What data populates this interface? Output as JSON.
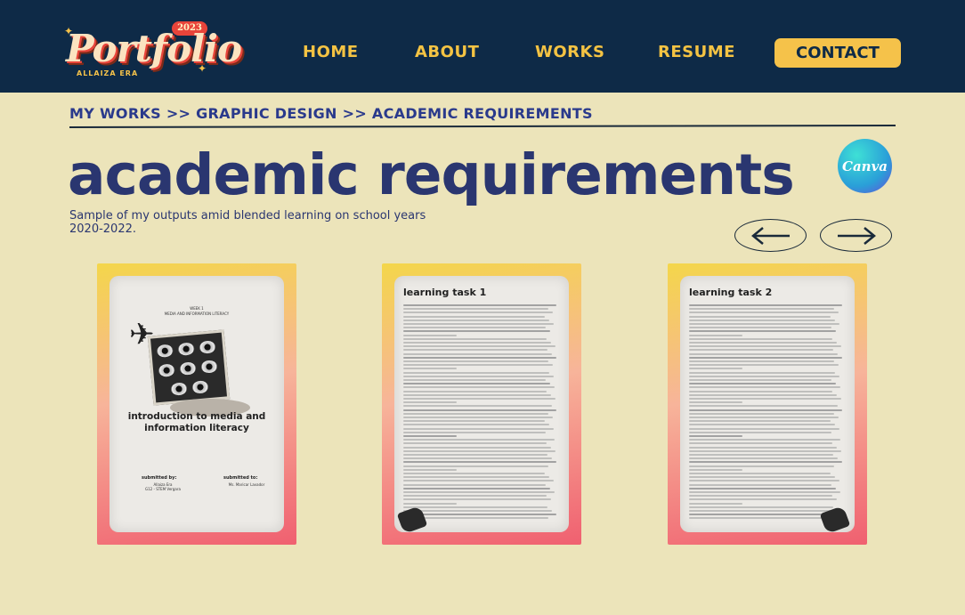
{
  "header": {
    "logo": {
      "word": "Portfolio",
      "year": "2023",
      "sub": "ALLAIZA ERA"
    },
    "nav": [
      {
        "label": "HOME"
      },
      {
        "label": "ABOUT"
      },
      {
        "label": "WORKS"
      },
      {
        "label": "RESUME"
      }
    ],
    "contact_label": "CONTACT"
  },
  "breadcrumb": "MY WORKS >> GRAPHIC DESIGN >> ACADEMIC REQUIREMENTS",
  "page_title": "academic requirements",
  "subtitle": "Sample of my outputs amid blended learning on school years 2020-2022.",
  "badge": {
    "label": "Canva",
    "icon": "canva-logo"
  },
  "arrows": {
    "prev_icon": "arrow-left-icon",
    "next_icon": "arrow-right-icon"
  },
  "cards": [
    {
      "week": "WEEK 1",
      "course": "MEDIA AND INFORMATION LITERACY",
      "title_line1": "introduction to media and",
      "title_line2": "information literacy",
      "submitted_by_label": "submitted by:",
      "submitted_by_name": "Allaiza Era",
      "submitted_by_section": "G12 - STEM Vergara",
      "submitted_to_label": "submitted to:",
      "submitted_to_name": "Ms. Maricar Lavador"
    },
    {
      "title": "learning task 1"
    },
    {
      "title": "learning task 2"
    }
  ],
  "colors": {
    "navbar": "#0e2a47",
    "accent": "#f5c24a",
    "background": "#ece4ba",
    "title": "#2a3670",
    "breadcrumb": "#2a3a8c"
  }
}
